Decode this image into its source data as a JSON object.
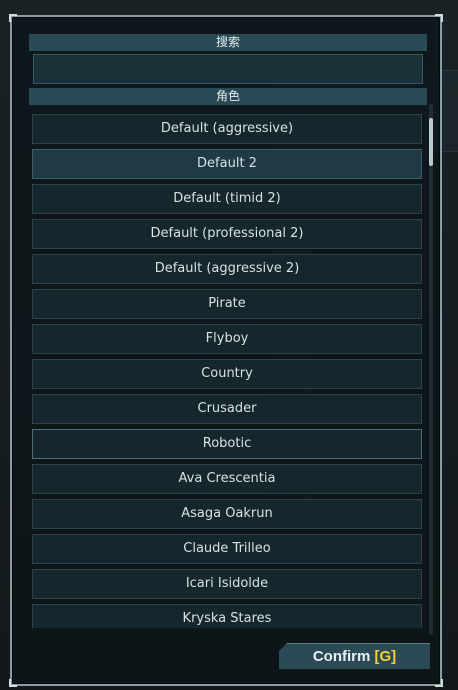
{
  "search": {
    "header": "搜索",
    "value": ""
  },
  "roles": {
    "header": "角色",
    "items": [
      {
        "label": "Default (aggressive)"
      },
      {
        "label": "Default 2"
      },
      {
        "label": "Default (timid 2)"
      },
      {
        "label": "Default (professional 2)"
      },
      {
        "label": "Default (aggressive 2)"
      },
      {
        "label": "Pirate"
      },
      {
        "label": "Flyboy"
      },
      {
        "label": "Country"
      },
      {
        "label": "Crusader"
      },
      {
        "label": "Robotic"
      },
      {
        "label": "Ava Crescentia"
      },
      {
        "label": "Asaga Oakrun"
      },
      {
        "label": "Claude Trilleo"
      },
      {
        "label": "Icari Isidolde"
      },
      {
        "label": "Kryska Stares"
      }
    ],
    "selected_index": 1
  },
  "footer": {
    "confirm_label": "Confirm ",
    "key_hint": "[G]"
  },
  "colors": {
    "accent": "#2a4a55",
    "key_hint": "#f2d03a",
    "border": "#8a9da3"
  }
}
